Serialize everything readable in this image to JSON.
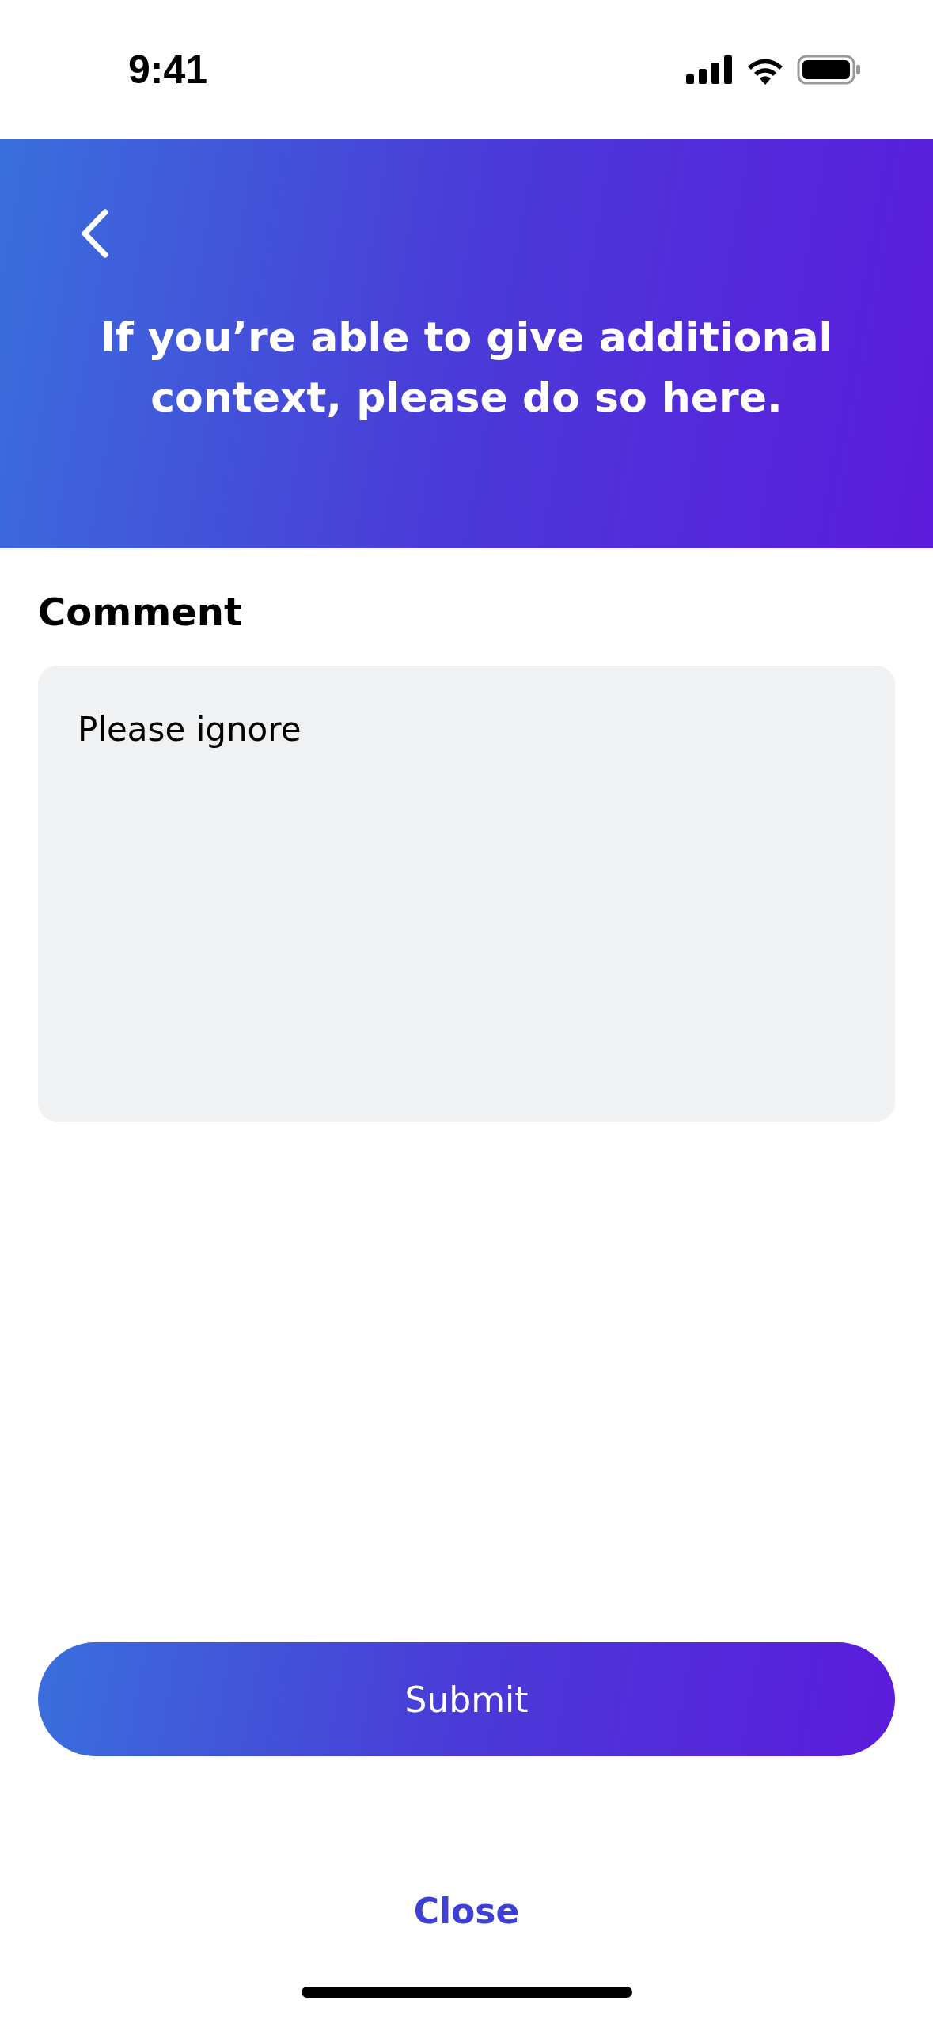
{
  "status_bar": {
    "time": "9:41"
  },
  "header": {
    "title": "If you’re able to give additional context, please do so here."
  },
  "comment": {
    "label": "Comment",
    "value": "Please ignore"
  },
  "submit": {
    "label": "Submit"
  },
  "close": {
    "label": "Close"
  }
}
